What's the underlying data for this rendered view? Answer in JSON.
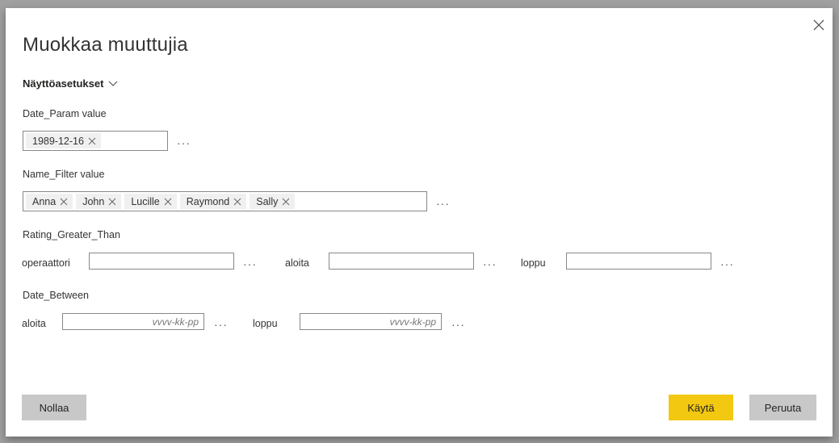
{
  "dialog": {
    "title": "Muokkaa muuttujia",
    "section_label": "Näyttöasetukset"
  },
  "fields": {
    "date_param": {
      "label": "Date_Param value",
      "chips": [
        "1989-12-16"
      ]
    },
    "name_filter": {
      "label": "Name_Filter value",
      "chips": [
        "Anna",
        "John",
        "Lucille",
        "Raymond",
        "Sally"
      ]
    },
    "rating_greater_than": {
      "label": "Rating_Greater_Than",
      "operator_label": "operaattori",
      "operator_value": "",
      "start_label": "aloita",
      "start_value": "",
      "end_label": "loppu",
      "end_value": ""
    },
    "date_between": {
      "label": "Date_Between",
      "start_label": "aloita",
      "start_placeholder": "vvvv-kk-pp",
      "end_label": "loppu",
      "end_placeholder": "vvvv-kk-pp"
    }
  },
  "more_glyph": "···",
  "buttons": {
    "reset": "Nollaa",
    "apply": "Käytä",
    "cancel": "Peruuta"
  },
  "colors": {
    "apply_button": "#f2c811",
    "secondary_button": "#c8c8c8",
    "backdrop": "#a0a0a0"
  }
}
